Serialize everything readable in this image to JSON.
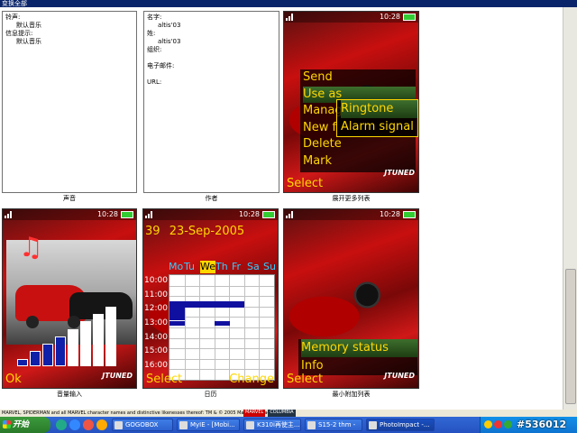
{
  "window": {
    "title": "变换全部"
  },
  "settings_panel": {
    "rows": [
      "铃声:",
      "默认音乐",
      "信息提示:",
      "默认音乐"
    ],
    "caption": "声音"
  },
  "contact_panel": {
    "rows": [
      {
        "label": "名字:",
        "value": "altis'03"
      },
      {
        "label": "姓:",
        "value": "altis'03"
      },
      {
        "label": "组织:",
        "value": ""
      },
      {
        "label": "电子邮件:",
        "value": ""
      },
      {
        "label": "URL:",
        "value": ""
      }
    ],
    "caption": "作者"
  },
  "screen_menu": {
    "clock": "10:28",
    "menu_items": [
      "Send",
      "Use as",
      "Manage",
      "New f",
      "Delete",
      "Mark"
    ],
    "submenu_items": [
      "Ringtone",
      "Alarm signal"
    ],
    "softkey_left": "Select",
    "brand": "JTUNED",
    "caption": "展开更多列表"
  },
  "screen_volume": {
    "clock": "10:28",
    "volume_level": 0.75,
    "softkey_left": "Ok",
    "brand": "JTUNED",
    "caption": "音量输入"
  },
  "screen_calendar": {
    "clock": "10:28",
    "week_number": "39",
    "date": "23-Sep-2005",
    "weekdays": [
      "Mo",
      "Tu",
      "We",
      "Th",
      "Fr",
      "Sa",
      "Su"
    ],
    "highlighted_day": "We",
    "times": [
      "10:00",
      "11:00",
      "12:00",
      "13:00",
      "14:00",
      "15:00",
      "16:00"
    ],
    "softkey_left": "Select",
    "softkey_right": "Change",
    "caption": "日历"
  },
  "screen_memory": {
    "clock": "10:28",
    "menu_items": [
      "Memory status",
      "Info"
    ],
    "softkey_left": "Select",
    "brand": "JTUNED",
    "caption": "最小附加列表"
  },
  "footer": {
    "copyright": "MARVEL, SPIDERMAN and all MARVEL character names and distinctive likenesses thereof: TM & © 2005 Marvel Characters, Inc.",
    "logo1": "MARVEL",
    "logo2": "COLUMBIA"
  },
  "taskbar": {
    "start_label": "开始",
    "tasks": [
      "GOGOBOX",
      "MyIE - [Mobi...",
      "K310i再使主...",
      "S15-2 thm -",
      "PhotoImpact -..."
    ],
    "post_id": "#536012"
  },
  "colors": {
    "softkey": "#ffd700",
    "taskbar": "#3168d5",
    "menu_highlight": "#3d6e2d"
  }
}
